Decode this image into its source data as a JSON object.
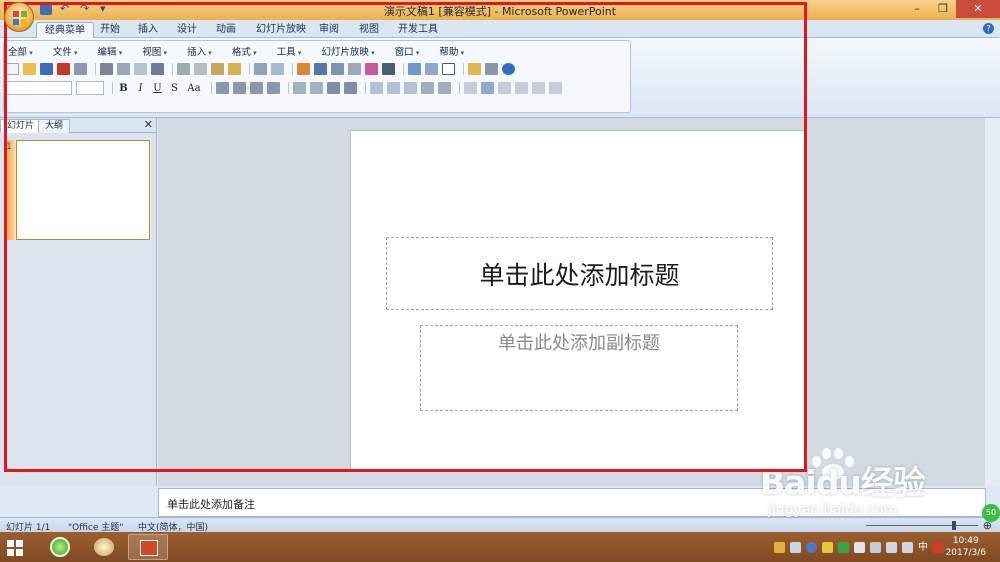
{
  "window": {
    "title": "演示文稿1 [兼容模式] - Microsoft PowerPoint",
    "controls": [
      "–",
      "❐",
      "✕"
    ]
  },
  "ribbon_tabs": [
    "经典菜单",
    "开始",
    "插入",
    "设计",
    "动画",
    "幻灯片放映",
    "审阅",
    "视图",
    "开发工具"
  ],
  "active_tab": "经典菜单",
  "classic_menu": [
    "全部",
    "文件",
    "编辑",
    "视图",
    "插入",
    "格式",
    "工具",
    "幻灯片放映",
    "窗口",
    "帮助"
  ],
  "format_buttons": [
    "B",
    "I",
    "U",
    "S",
    "Aa"
  ],
  "left_pane": {
    "tabs": [
      "幻灯片",
      "大纲"
    ],
    "close": "✕",
    "slide_number": "1"
  },
  "slide": {
    "title_placeholder": "单击此处添加标题",
    "subtitle_placeholder": "单击此处添加副标题"
  },
  "notes": {
    "placeholder": "单击此处添加备注"
  },
  "status_bar": {
    "slide_info": "幻灯片 1/1",
    "theme": "\"Office 主题\"",
    "language": "中文(简体，中国)",
    "zoom_plus": "⊕"
  },
  "taskbar": {
    "time": "10:49",
    "date": "2017/3/6",
    "input_lang": "中",
    "badge": "50"
  },
  "watermark": {
    "brand": "Baidu经验",
    "url": "jingyan.baidu.com"
  },
  "colors": {
    "highlight": "#e3161e",
    "title_bar": "#eeb04e",
    "taskbar": "#8a5227"
  }
}
